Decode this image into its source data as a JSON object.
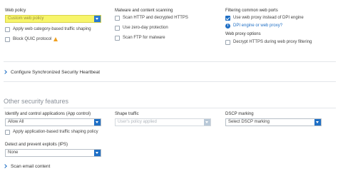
{
  "web_policy": {
    "label": "Web policy",
    "selected": "Custom web policy",
    "shaping_label": "Apply web category-based traffic shaping",
    "quic_label": "Block QUIC protocol"
  },
  "malware": {
    "label": "Malware and content scanning",
    "scan_http_label": "Scan HTTP and decrypted HTTPS",
    "zero_day_label": "Use zero-day protection",
    "ftp_label": "Scan FTP for malware"
  },
  "filtering": {
    "label": "Filtering common web ports",
    "use_proxy_label": "Use web proxy instead of DPI engine",
    "dpi_link": "DPI engine or web proxy?"
  },
  "proxy_options": {
    "label": "Web proxy options",
    "decrypt_label": "Decrypt HTTPS during web proxy filtering"
  },
  "heartbeat": {
    "label": "Configure Synchronized Security Heartbeat"
  },
  "other_security": {
    "title": "Other security features",
    "app_control": {
      "label": "Identify and control applications (App control)",
      "selected": "Allow All",
      "shaping_label": "Apply application-based traffic shaping policy"
    },
    "shape_traffic": {
      "label": "Shape traffic",
      "selected": "User's policy applied"
    },
    "dscp": {
      "label": "DSCP marking",
      "selected": "Select DSCP marking"
    },
    "ips": {
      "label": "Detect and prevent exploits (IPS)",
      "selected": "None"
    }
  },
  "email": {
    "label": "Scan email content"
  },
  "colors": {
    "accent": "#1f6fc5",
    "highlight": "#f7f56a",
    "warning": "#f0a020"
  }
}
